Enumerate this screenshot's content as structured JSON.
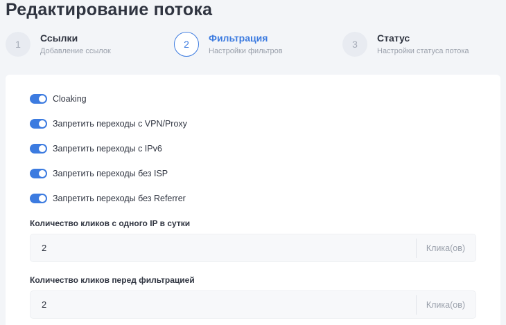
{
  "page": {
    "title": "Редактирование потока"
  },
  "steps": [
    {
      "number": "1",
      "title": "Ссылки",
      "subtitle": "Добавление ссылок"
    },
    {
      "number": "2",
      "title": "Фильтрация",
      "subtitle": "Настройки фильтров"
    },
    {
      "number": "3",
      "title": "Статус",
      "subtitle": "Настройки статуса потока"
    }
  ],
  "toggles": [
    {
      "label": "Cloaking",
      "enabled": true
    },
    {
      "label": "Запретить переходы с VPN/Proxy",
      "enabled": true
    },
    {
      "label": "Запретить переходы с IPv6",
      "enabled": true
    },
    {
      "label": "Запретить переходы без ISP",
      "enabled": true
    },
    {
      "label": "Запретить переходы без Referrer",
      "enabled": true
    }
  ],
  "fields": [
    {
      "label": "Количество кликов с одного IP в сутки",
      "value": "2",
      "suffix": "Клика(ов)"
    },
    {
      "label": "Количество кликов перед фильтрацией",
      "value": "2",
      "suffix": "Клика(ов)"
    }
  ],
  "colors": {
    "accent": "#3c7be0",
    "background": "#f3f5f8",
    "card": "#ffffff"
  }
}
